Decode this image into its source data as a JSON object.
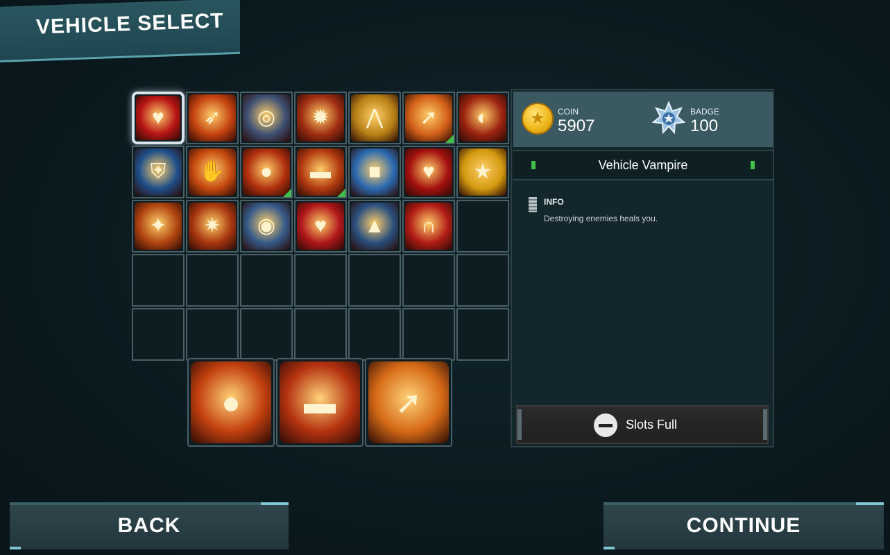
{
  "screen": {
    "title": "VEHICLE SELECT"
  },
  "currency": {
    "coin_label": "COIN",
    "coin_value": "5907",
    "badge_label": "BADGE",
    "badge_value": "100"
  },
  "selected_item": {
    "name": "Vehicle Vampire",
    "info_heading": "INFO",
    "description": "Destroying enemies heals you."
  },
  "slots_status": {
    "label": "Slots Full"
  },
  "buttons": {
    "back": "BACK",
    "continue": "CONTINUE"
  },
  "colors": {
    "accent": "#7fc6d0",
    "panel": "#13262c",
    "upgrade_marker": "#3ec04a"
  },
  "grid": {
    "columns": 7,
    "rows": 5,
    "items": [
      {
        "icon": "vampire-heart-icon",
        "glyph": "♥",
        "bg": "#b71515",
        "selected": true,
        "upgrade": false
      },
      {
        "icon": "missile-speed-icon",
        "glyph": "➶",
        "bg": "#c4410f",
        "selected": false,
        "upgrade": false
      },
      {
        "icon": "shield-pierce-icon",
        "glyph": "◎",
        "bg": "#3d4f73",
        "selected": false,
        "upgrade": false
      },
      {
        "icon": "shield-bomb-icon",
        "glyph": "✹",
        "bg": "#a02d12",
        "selected": false,
        "upgrade": false
      },
      {
        "icon": "rank-up-icon",
        "glyph": "⋀",
        "bg": "#b88016",
        "selected": false,
        "upgrade": false
      },
      {
        "icon": "rocket-barrage-icon",
        "glyph": "➚",
        "bg": "#d26018",
        "selected": false,
        "upgrade": true
      },
      {
        "icon": "fire-wheel-icon",
        "glyph": "◐",
        "bg": "#9b2410",
        "selected": false,
        "upgrade": false
      },
      {
        "icon": "armor-shield-icon",
        "glyph": "⛨",
        "bg": "#1e4f8a",
        "selected": false,
        "upgrade": false
      },
      {
        "icon": "handshake-icon",
        "glyph": "✋",
        "bg": "#c5490f",
        "selected": false,
        "upgrade": false
      },
      {
        "icon": "coin-shot-icon",
        "glyph": "●",
        "bg": "#b1300e",
        "selected": false,
        "upgrade": true
      },
      {
        "icon": "tank-icon",
        "glyph": "▬",
        "bg": "#b33a10",
        "selected": false,
        "upgrade": true
      },
      {
        "icon": "crate-drop-icon",
        "glyph": "■",
        "bg": "#2a69b0",
        "selected": false,
        "upgrade": false
      },
      {
        "icon": "double-heart-icon",
        "glyph": "♥",
        "bg": "#a5110f",
        "selected": false,
        "upgrade": false
      },
      {
        "icon": "star-coin-icon",
        "glyph": "★",
        "bg": "#d59a10",
        "selected": false,
        "upgrade": false
      },
      {
        "icon": "coin-blast-icon",
        "glyph": "✦",
        "bg": "#b04410",
        "selected": false,
        "upgrade": false
      },
      {
        "icon": "double-blast-icon",
        "glyph": "✷",
        "bg": "#a8360f",
        "selected": false,
        "upgrade": false
      },
      {
        "icon": "multi-shield-icon",
        "glyph": "◉",
        "bg": "#355a8a",
        "selected": false,
        "upgrade": false
      },
      {
        "icon": "heart-orbit-icon",
        "glyph": "♥",
        "bg": "#b0171a",
        "selected": false,
        "upgrade": false
      },
      {
        "icon": "turret-icon",
        "glyph": "▲",
        "bg": "#294f7e",
        "selected": false,
        "upgrade": false
      },
      {
        "icon": "magnet-icon",
        "glyph": "∩",
        "bg": "#b11c16",
        "selected": false,
        "upgrade": false
      }
    ]
  },
  "equipped": [
    {
      "icon": "coin-shot-icon",
      "glyph": "●",
      "bg": "#c3400f"
    },
    {
      "icon": "tank-icon",
      "glyph": "▬",
      "bg": "#b4320f"
    },
    {
      "icon": "rocket-barrage-icon",
      "glyph": "➚",
      "bg": "#d66a16"
    }
  ]
}
